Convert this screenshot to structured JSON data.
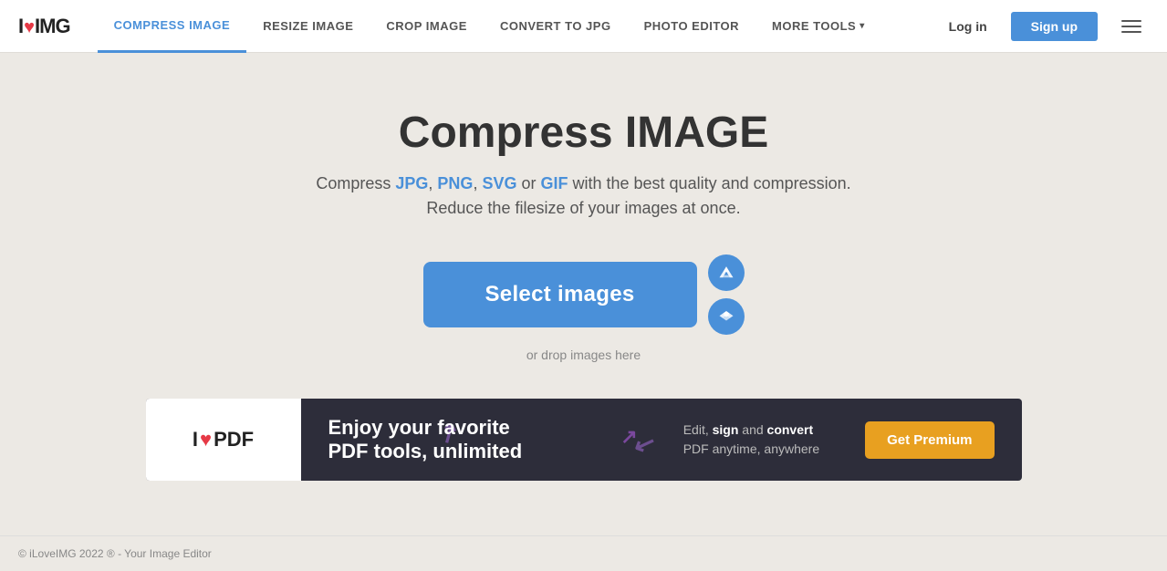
{
  "brand": {
    "name_part1": "I",
    "heart": "♥",
    "name_part2": "IMG"
  },
  "nav": {
    "links": [
      {
        "label": "COMPRESS IMAGE",
        "active": true,
        "id": "compress"
      },
      {
        "label": "RESIZE IMAGE",
        "active": false,
        "id": "resize"
      },
      {
        "label": "CROP IMAGE",
        "active": false,
        "id": "crop"
      },
      {
        "label": "CONVERT TO JPG",
        "active": false,
        "id": "convert"
      },
      {
        "label": "PHOTO EDITOR",
        "active": false,
        "id": "photo"
      },
      {
        "label": "MORE TOOLS",
        "active": false,
        "id": "more",
        "has_arrow": true
      }
    ],
    "login_label": "Log in",
    "signup_label": "Sign up"
  },
  "hero": {
    "title": "Compress IMAGE",
    "subtitle_prefix": "Compress ",
    "jpg": "JPG",
    "comma1": ", ",
    "png": "PNG",
    "comma2": ", ",
    "svg": "SVG",
    "or": " or ",
    "gif": "GIF",
    "subtitle_suffix": " with the best quality and compression.",
    "subtitle2": "Reduce the filesize of your images at once.",
    "select_btn": "Select images",
    "drop_text": "or drop images here"
  },
  "ad": {
    "logo_part1": "I",
    "logo_heart": "♥",
    "logo_part2": "PDF",
    "headline_line1": "Enjoy your favorite",
    "headline_line2": "PDF tools, unlimited",
    "sub_prefix": "Edit, ",
    "sub_sign": "sign",
    "sub_mid": " and ",
    "sub_convert": "convert",
    "sub_suffix": " PDF anytime, anywhere",
    "cta": "Get Premium"
  },
  "footer": {
    "text": "© iLoveIMG 2022 ® - Your Image Editor"
  },
  "colors": {
    "blue": "#4a90d9",
    "dark_bg": "#2d2d3a",
    "gold": "#e8a020"
  }
}
